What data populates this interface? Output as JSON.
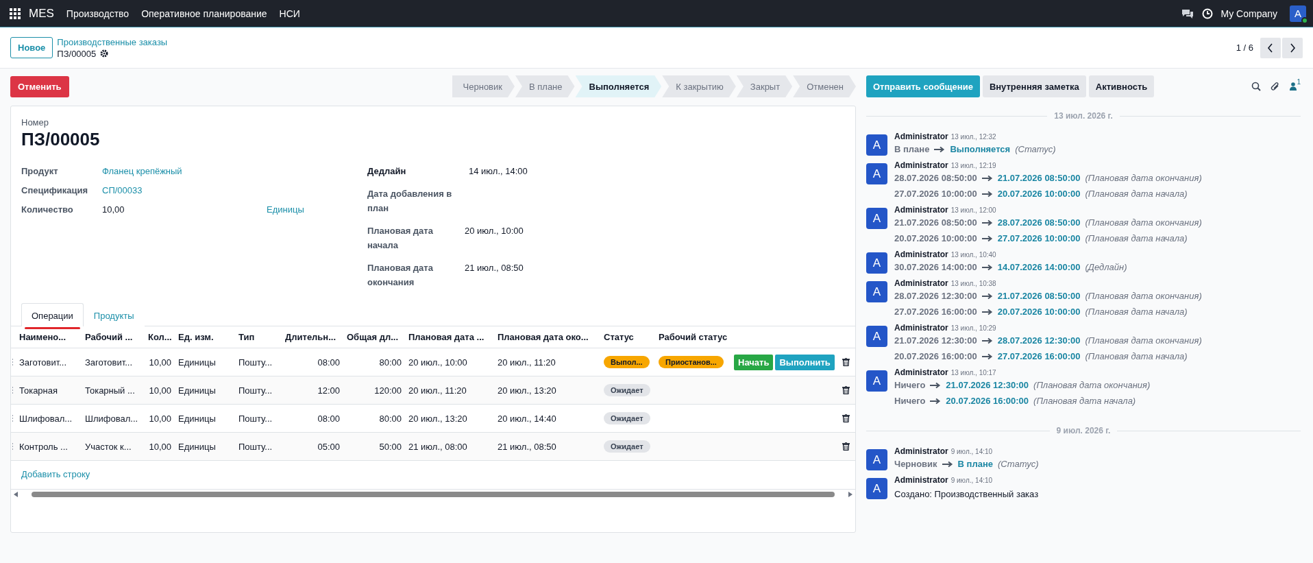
{
  "navbar": {
    "app": "MES",
    "menu": [
      "Производство",
      "Оперативное планирование",
      "НСИ"
    ],
    "company": "My Company",
    "avatar": "A",
    "online": true
  },
  "control_panel": {
    "new_button": "Новое",
    "breadcrumb": "Производственные заказы",
    "record": "ПЗ/00005",
    "pager": "1 / 6"
  },
  "cancel_button": "Отменить",
  "stages": [
    {
      "label": "Черновик",
      "selected": false
    },
    {
      "label": "В плане",
      "selected": false
    },
    {
      "label": "Выполняется",
      "selected": true
    },
    {
      "label": "К закрытию",
      "selected": false
    },
    {
      "label": "Закрыт",
      "selected": false
    },
    {
      "label": "Отменен",
      "selected": false
    }
  ],
  "chatter_buttons": [
    {
      "label": "Отправить сообщение",
      "selected": true
    },
    {
      "label": "Внутренняя заметка",
      "selected": false
    },
    {
      "label": "Активность",
      "selected": false
    }
  ],
  "followers_count": "1",
  "form": {
    "number_label": "Номер",
    "number": "ПЗ/00005",
    "left_fields": [
      {
        "label": "Продукт",
        "value": "Фланец крепёжный",
        "kind": "link"
      },
      {
        "label": "Спецификация",
        "value": "СП/00033",
        "kind": "link"
      },
      {
        "label": "Количество",
        "value": "10,00",
        "unit": "Единицы",
        "kind": "quantity"
      }
    ],
    "right_fields": [
      {
        "label": "Дедлайн",
        "value": "14 июл., 14:00",
        "bold": true
      },
      {
        "label": "Дата добавления в план",
        "bold": false
      },
      {
        "label": "Плановая дата начала",
        "value": "20 июл., 10:00",
        "bold": false
      },
      {
        "label": "Плановая дата окончания",
        "value": "21 июл., 08:50",
        "bold": false
      }
    ]
  },
  "tabs": [
    {
      "label": "Операции",
      "selected": true
    },
    {
      "label": "Продукты",
      "selected": false
    }
  ],
  "table": {
    "columns": [
      "Наимено...",
      "Рабочий ...",
      "Кол...",
      "Ед. изм.",
      "Тип",
      "Длительн...",
      "Общая дл...",
      "Плановая дата ...",
      "Плановая дата око...",
      "Статус",
      "Рабочий статус"
    ],
    "rows": [
      {
        "cells": [
          "Заготовит...",
          "Заготовит...",
          "10,00",
          "Единицы",
          "Пошту...",
          "08:00",
          "80:00",
          "20 июл., 10:00",
          "20 июл., 11:20"
        ],
        "status": {
          "text": "Выпол...",
          "color": "#f7a600"
        },
        "work_status": {
          "text": "Приостанов...",
          "color": "#f7a600"
        },
        "actions": [
          {
            "label": "Начать",
            "kind": "start"
          },
          {
            "label": "Выполнить",
            "kind": "finish"
          }
        ]
      },
      {
        "cells": [
          "Токарная",
          "Токарный ...",
          "10,00",
          "Единицы",
          "Пошту...",
          "12:00",
          "120:00",
          "20 июл., 11:20",
          "20 июл., 13:20"
        ],
        "status": {
          "text": "Ожидает",
          "color": "#e2e4e8"
        }
      },
      {
        "cells": [
          "Шлифовал...",
          "Шлифовал...",
          "10,00",
          "Единицы",
          "Пошту...",
          "08:00",
          "80:00",
          "20 июл., 13:20",
          "20 июл., 14:40"
        ],
        "status": {
          "text": "Ожидает",
          "color": "#e2e4e8"
        }
      },
      {
        "cells": [
          "Контроль ...",
          "Участок к...",
          "10,00",
          "Единицы",
          "Пошту...",
          "05:00",
          "50:00",
          "21 июл., 08:00",
          "21 июл., 08:50"
        ],
        "status": {
          "text": "Ожидает",
          "color": "#e2e4e8"
        }
      }
    ],
    "add_line": "Добавить строку"
  },
  "chatter": [
    {
      "date": "13 июл. 2026 г.",
      "messages": [
        {
          "avatar": "A",
          "author": "Administrator",
          "time": "13 июл., 12:32",
          "changes": [
            {
              "old": "В плане",
              "new": "Выполняется",
              "field": "(Статус)"
            }
          ]
        },
        {
          "avatar": "A",
          "author": "Administrator",
          "time": "13 июл., 12:19",
          "changes": [
            {
              "old": "28.07.2026 08:50:00",
              "new": "21.07.2026 08:50:00",
              "field": "(Плановая дата окончания)"
            },
            {
              "old": "27.07.2026 10:00:00",
              "new": "20.07.2026 10:00:00",
              "field": "(Плановая дата начала)"
            }
          ]
        },
        {
          "avatar": "A",
          "author": "Administrator",
          "time": "13 июл., 12:00",
          "changes": [
            {
              "old": "21.07.2026 08:50:00",
              "new": "28.07.2026 08:50:00",
              "field": "(Плановая дата окончания)"
            },
            {
              "old": "20.07.2026 10:00:00",
              "new": "27.07.2026 10:00:00",
              "field": "(Плановая дата начала)"
            }
          ]
        },
        {
          "avatar": "A",
          "author": "Administrator",
          "time": "13 июл., 10:40",
          "changes": [
            {
              "old": "30.07.2026 14:00:00",
              "new": "14.07.2026 14:00:00",
              "field": "(Дедлайн)"
            }
          ]
        },
        {
          "avatar": "A",
          "author": "Administrator",
          "time": "13 июл., 10:38",
          "changes": [
            {
              "old": "28.07.2026 12:30:00",
              "new": "21.07.2026 08:50:00",
              "field": "(Плановая дата окончания)"
            },
            {
              "old": "27.07.2026 16:00:00",
              "new": "20.07.2026 10:00:00",
              "field": "(Плановая дата начала)"
            }
          ]
        },
        {
          "avatar": "A",
          "author": "Administrator",
          "time": "13 июл., 10:29",
          "changes": [
            {
              "old": "21.07.2026 12:30:00",
              "new": "28.07.2026 12:30:00",
              "field": "(Плановая дата окончания)"
            },
            {
              "old": "20.07.2026 16:00:00",
              "new": "27.07.2026 16:00:00",
              "field": "(Плановая дата начала)"
            }
          ]
        },
        {
          "avatar": "A",
          "author": "Administrator",
          "time": "13 июл., 10:17",
          "changes": [
            {
              "old": "Ничего",
              "new": "21.07.2026 12:30:00",
              "field": "(Плановая дата окончания)"
            },
            {
              "old": "Ничего",
              "new": "20.07.2026 16:00:00",
              "field": "(Плановая дата начала)"
            }
          ]
        }
      ]
    },
    {
      "date": "9 июл. 2026 г.",
      "messages": [
        {
          "avatar": "A",
          "author": "Administrator",
          "time": "9 июл., 14:10",
          "changes": [
            {
              "old": "Черновик",
              "new": "В плане",
              "field": "(Статус)"
            }
          ]
        },
        {
          "avatar": "A",
          "author": "Administrator",
          "time": "9 июл., 14:10",
          "body": "Создано: Производственный заказ"
        }
      ]
    }
  ]
}
